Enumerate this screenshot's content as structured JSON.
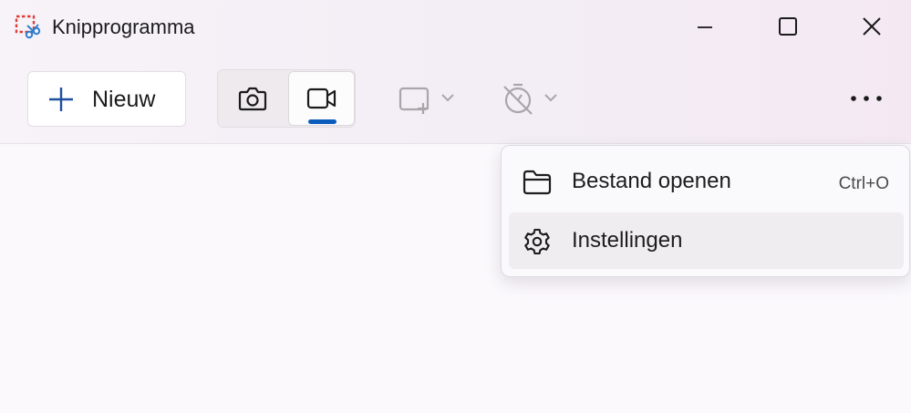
{
  "window": {
    "title": "Knipprogramma",
    "app_icon": "snipping-tool-icon",
    "minimize_icon": "minimize-icon",
    "maximize_icon": "maximize-icon",
    "close_icon": "close-icon"
  },
  "toolbar": {
    "new_label": "Nieuw",
    "new_icon": "plus-icon",
    "modes": [
      {
        "name": "screenshot",
        "icon": "camera-icon",
        "selected": false
      },
      {
        "name": "video",
        "icon": "video-camera-icon",
        "selected": true
      }
    ],
    "shape_icon": "rectangle-snip-icon",
    "timer_icon": "timer-off-icon",
    "more_icon": "more-icon"
  },
  "menu": {
    "items": [
      {
        "label": "Bestand openen",
        "shortcut": "Ctrl+O",
        "icon": "folder-icon",
        "hovered": false
      },
      {
        "label": "Instellingen",
        "shortcut": "",
        "icon": "settings-gear-icon",
        "hovered": true
      }
    ]
  },
  "colors": {
    "accent": "#0a5cbd",
    "disabled_icon": "#a9a6ab",
    "app_icon_red": "#d9403a",
    "app_icon_blue": "#2f7fd0"
  }
}
